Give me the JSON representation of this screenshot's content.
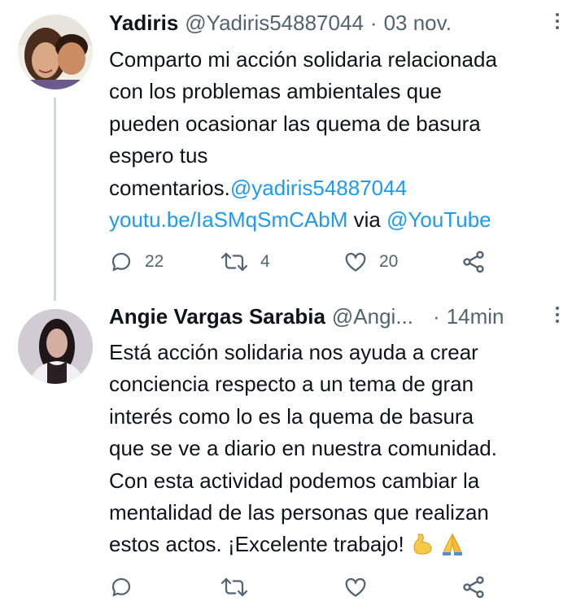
{
  "tweets": [
    {
      "display_name": "Yadiris",
      "handle": "@Yadiris54887044",
      "separator": "·",
      "time": "03 nov.",
      "text_lines": [
        "Comparto mi acción solidaria relacionada",
        "con los problemas ambientales que",
        "pueden ocasionar las quema de basura",
        "espero tus"
      ],
      "text_last_prefix": "comentarios.",
      "mention_1": "@yadiris54887044",
      "link_url": "youtu.be/IaSMqSmCAbM",
      "via_text": "via",
      "mention_2": "@YouTube",
      "replies": "22",
      "retweets": "4",
      "likes": "20"
    },
    {
      "display_name": "Angie Vargas Sarabia",
      "handle": "@Angi...",
      "separator": "·",
      "time": "14min",
      "text_lines": [
        "Está acción solidaria nos ayuda a crear",
        "conciencia respecto a un tema de gran",
        "interés como lo es la quema de basura",
        "que se ve a diario en nuestra comunidad.",
        "Con esta actividad podemos cambiar la",
        "mentalidad de las personas que realizan"
      ],
      "text_last": "estos actos. ¡Excelente trabajo!",
      "emojis": [
        "flexed-biceps",
        "folded-hands"
      ]
    }
  ],
  "icons": {
    "reply": "reply-icon",
    "retweet": "retweet-icon",
    "like": "heart-icon",
    "share": "share-icon",
    "more": "more-vertical-icon"
  },
  "colors": {
    "text": "#0f1419",
    "secondary": "#536471",
    "link": "#1d9bf0",
    "thread_line": "#cfd9de"
  }
}
